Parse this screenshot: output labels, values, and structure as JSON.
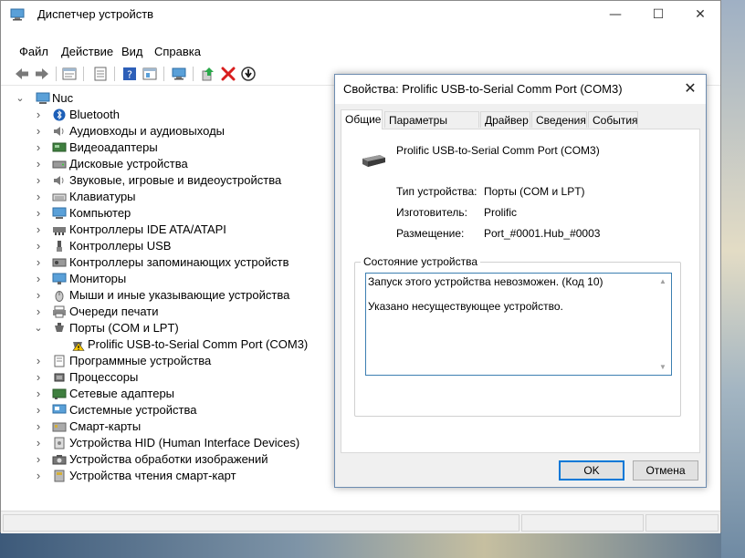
{
  "window": {
    "title": "Диспетчер устройств",
    "minimize": "—",
    "maximize": "☐",
    "close": "✕"
  },
  "menu": [
    "Файл",
    "Действие",
    "Вид",
    "Справка"
  ],
  "tree": {
    "root": "Nuc",
    "items": [
      {
        "label": "Bluetooth",
        "icon": "bluetooth-icon"
      },
      {
        "label": "Аудиовходы и аудиовыходы",
        "icon": "speaker-icon"
      },
      {
        "label": "Видеоадаптеры",
        "icon": "display-adapter-icon"
      },
      {
        "label": "Дисковые устройства",
        "icon": "disk-drive-icon"
      },
      {
        "label": "Звуковые, игровые и видеоустройства",
        "icon": "speaker-icon"
      },
      {
        "label": "Клавиатуры",
        "icon": "keyboard-icon"
      },
      {
        "label": "Компьютер",
        "icon": "computer-icon"
      },
      {
        "label": "Контроллеры IDE ATA/ATAPI",
        "icon": "ide-controller-icon"
      },
      {
        "label": "Контроллеры USB",
        "icon": "usb-icon"
      },
      {
        "label": "Контроллеры запоминающих устройств",
        "icon": "storage-controller-icon"
      },
      {
        "label": "Мониторы",
        "icon": "monitor-icon"
      },
      {
        "label": "Мыши и иные указывающие устройства",
        "icon": "mouse-icon"
      },
      {
        "label": "Очереди печати",
        "icon": "printer-icon"
      },
      {
        "label": "Порты (COM и LPT)",
        "icon": "port-icon",
        "expanded": true
      },
      {
        "label": "Prolific USB-to-Serial Comm Port (COM3)",
        "icon": "warning-port-icon",
        "child": true
      },
      {
        "label": "Программные устройства",
        "icon": "software-device-icon"
      },
      {
        "label": "Процессоры",
        "icon": "processor-icon"
      },
      {
        "label": "Сетевые адаптеры",
        "icon": "network-adapter-icon"
      },
      {
        "label": "Системные устройства",
        "icon": "system-device-icon"
      },
      {
        "label": "Смарт-карты",
        "icon": "smart-card-icon"
      },
      {
        "label": "Устройства HID (Human Interface Devices)",
        "icon": "hid-icon"
      },
      {
        "label": "Устройства обработки изображений",
        "icon": "camera-icon"
      },
      {
        "label": "Устройства чтения смарт-карт",
        "icon": "card-reader-icon"
      }
    ]
  },
  "dialog": {
    "title": "Свойства: Prolific USB-to-Serial Comm Port (COM3)",
    "close": "✕",
    "tabs": [
      "Общие",
      "Параметры порта",
      "Драйвер",
      "Сведения",
      "События"
    ],
    "device_name": "Prolific USB-to-Serial Comm Port (COM3)",
    "props": [
      {
        "label": "Тип устройства:",
        "value": "Порты (COM и LPT)"
      },
      {
        "label": "Изготовитель:",
        "value": "Prolific"
      },
      {
        "label": "Размещение:",
        "value": "Port_#0001.Hub_#0003"
      }
    ],
    "status_group_label": "Состояние устройства",
    "status_lines": [
      "Запуск этого устройства невозможен. (Код 10)",
      "Указано несуществующее устройство."
    ],
    "ok": "OK",
    "cancel": "Отмена"
  }
}
